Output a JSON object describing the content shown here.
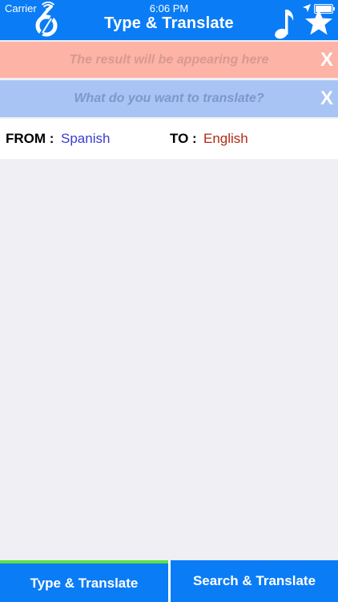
{
  "status_bar": {
    "carrier": "Carrier",
    "time": "6:06 PM"
  },
  "header": {
    "title": "Type & Translate",
    "icons": [
      "app-logo-icon",
      "music-note-icon",
      "star-icon"
    ]
  },
  "result": {
    "placeholder": "The result will be appearing here",
    "clear_label": "X"
  },
  "query": {
    "placeholder": "What do you want to translate?",
    "clear_label": "X"
  },
  "languages": {
    "from_label": "FROM :",
    "from_value": "Spanish",
    "to_label": "TO :",
    "to_value": "English"
  },
  "tabs": [
    {
      "label": "Type & Translate",
      "active": true
    },
    {
      "label": "Search & Translate",
      "active": false
    }
  ],
  "colors": {
    "primary": "#0a7cf5",
    "result_bg": "#fdb3a6",
    "query_bg": "#a7c4f4",
    "from_color": "#3a3bd1",
    "to_color": "#b22a14",
    "active_tab_indicator": "#5ee048"
  }
}
